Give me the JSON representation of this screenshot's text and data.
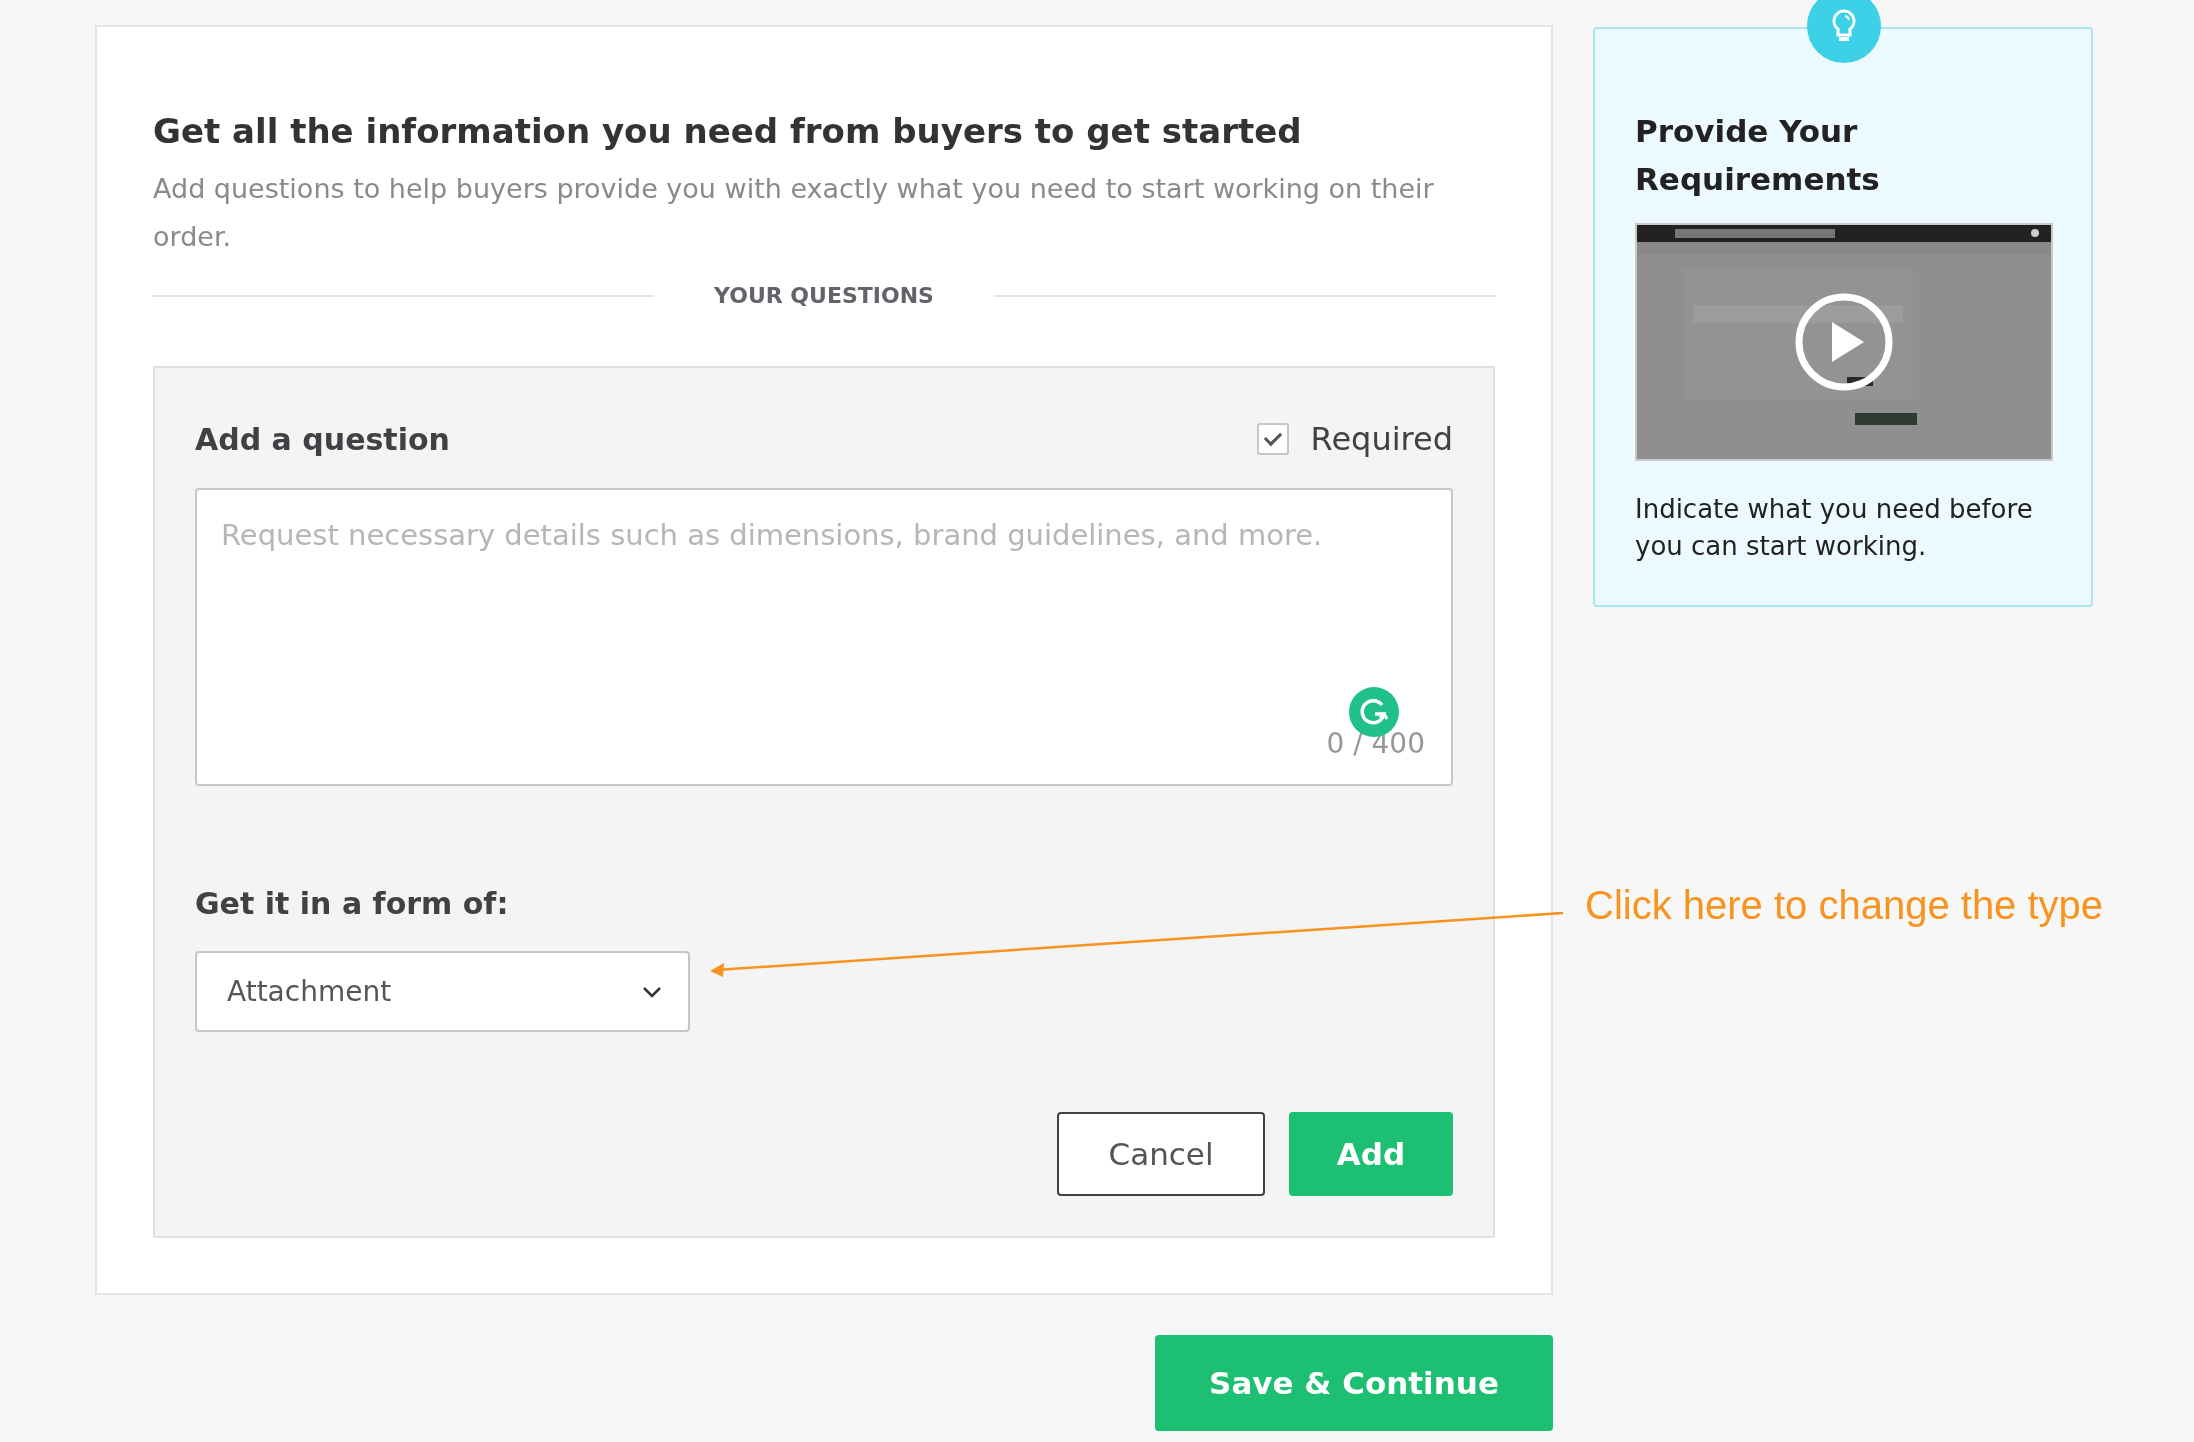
{
  "main": {
    "title": "Get all the information you need from buyers to get started",
    "subtitle": "Add questions to help buyers provide you with exactly what you need to start working on their order.",
    "section_label": "YOUR QUESTIONS",
    "question_form": {
      "heading": "Add a question",
      "required": {
        "label": "Required",
        "checked": true
      },
      "question_field": {
        "placeholder": "Request necessary details such as dimensions, brand guidelines, and more.",
        "counter": "0 / 400"
      },
      "form_label": "Get it in a form of:",
      "form_type": {
        "value": "Attachment"
      },
      "buttons": [
        {
          "label": "Cancel",
          "kind": "secondary"
        },
        {
          "label": "Add",
          "kind": "primary"
        }
      ]
    }
  },
  "save_button": {
    "label": "Save & Continue"
  },
  "tip_card": {
    "title": "Provide Your Requirements",
    "text": "Indicate what you need before you can start working."
  },
  "annotation": {
    "text": "Click here to change the type"
  }
}
